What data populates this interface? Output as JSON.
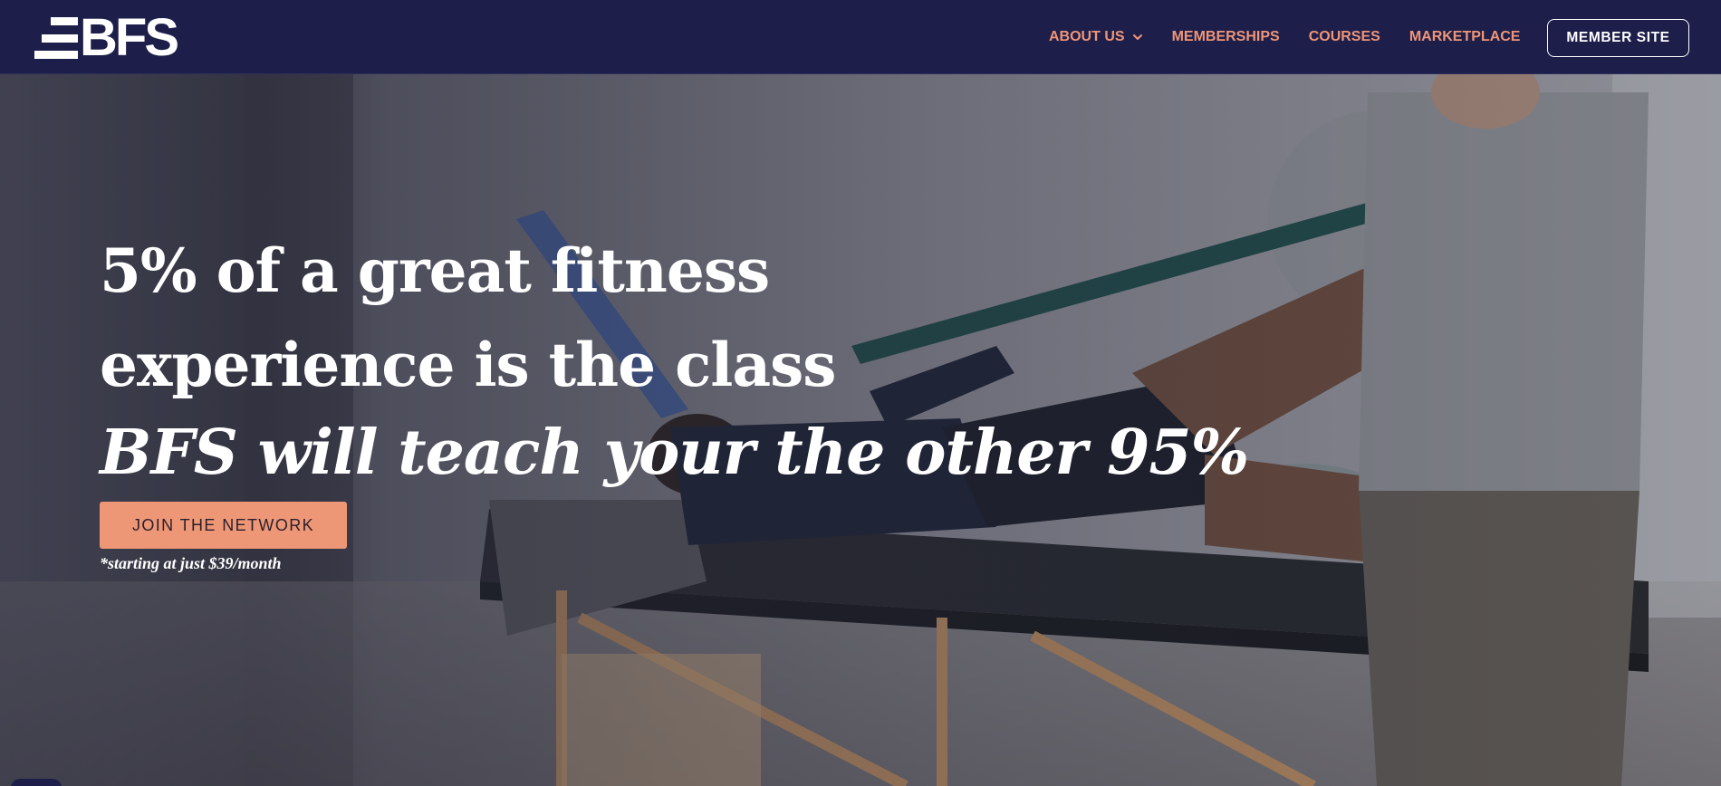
{
  "brand": {
    "logo_text": "BFS"
  },
  "nav": {
    "items": [
      {
        "label": "ABOUT US",
        "has_dropdown": true
      },
      {
        "label": "MEMBERSHIPS"
      },
      {
        "label": "COURSES"
      },
      {
        "label": "MARKETPLACE"
      }
    ],
    "member_button": "MEMBER SITE"
  },
  "hero": {
    "line1": "5% of a great fitness",
    "line2": "experience is the class",
    "line3": "BFS will teach your the other 95%",
    "cta_label": "JOIN THE NETWORK",
    "price_note": "*starting at just $39/month"
  },
  "colors": {
    "navbar": "#1d1f4a",
    "accent": "#ef9577",
    "cta_bg": "#ee9776",
    "text_light": "#ffffff"
  },
  "icons": {
    "dropdown": "chevron-down-icon"
  }
}
